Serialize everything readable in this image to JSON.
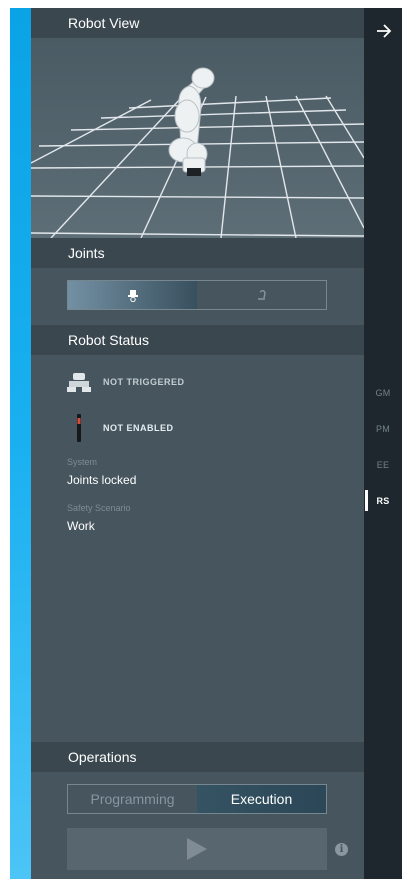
{
  "sections": {
    "robot_view": "Robot View",
    "joints": "Joints",
    "robot_status": "Robot Status",
    "operations": "Operations"
  },
  "status": {
    "trigger": "NOT TRIGGERED",
    "enable": "NOT ENABLED",
    "system_label": "System",
    "system_value": "Joints locked",
    "scenario_label": "Safety Scenario",
    "scenario_value": "Work"
  },
  "joints_toggle": {
    "selected": 0,
    "icons": [
      "hand-guide-icon",
      "arm-joint-icon"
    ]
  },
  "operations": {
    "programming": "Programming",
    "execution": "Execution",
    "selected": "Execution"
  },
  "sidenav": {
    "items": [
      "GM",
      "PM",
      "EE",
      "RS"
    ],
    "active": "RS"
  },
  "colors": {
    "accent": "#1ab0f0",
    "panel": "#46555e",
    "header": "#3a474f",
    "sidenav": "#1e272d",
    "active_segment": "#345363"
  }
}
